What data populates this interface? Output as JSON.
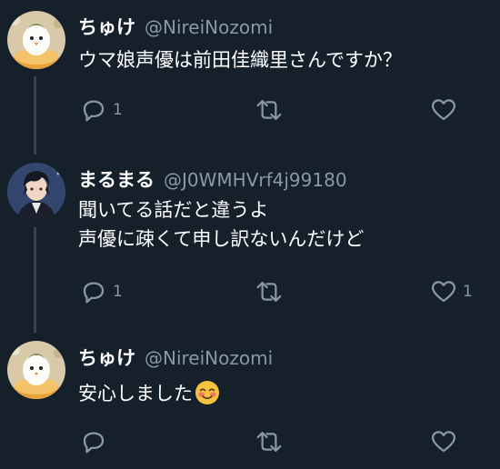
{
  "colors": {
    "background": "#15202b",
    "text_primary": "#ffffff",
    "text_secondary": "#8b98a5",
    "thread_line": "#38444d"
  },
  "tweets": [
    {
      "display_name": "ちゅけ",
      "handle": "@NireiNozomi",
      "text_lines": [
        "ウマ娘声優は前田佳織里さんですか？"
      ],
      "emoji": "",
      "reply_count": "1",
      "retweet_count": "",
      "like_count": "",
      "avatar_icon": "egg-character-avatar"
    },
    {
      "display_name": "まるまる",
      "handle": "@J0WMHVrf4j99180",
      "text_lines": [
        "聞いてる話だと違うよ",
        "声優に疎くて申し訳ないんだけど"
      ],
      "emoji": "",
      "reply_count": "1",
      "retweet_count": "",
      "like_count": "1",
      "avatar_icon": "anime-man-avatar"
    },
    {
      "display_name": "ちゅけ",
      "handle": "@NireiNozomi",
      "text_lines": [
        "安心しました"
      ],
      "emoji": "smiling-face-with-blush-icon",
      "reply_count": "",
      "retweet_count": "",
      "like_count": "",
      "avatar_icon": "egg-character-avatar"
    }
  ]
}
